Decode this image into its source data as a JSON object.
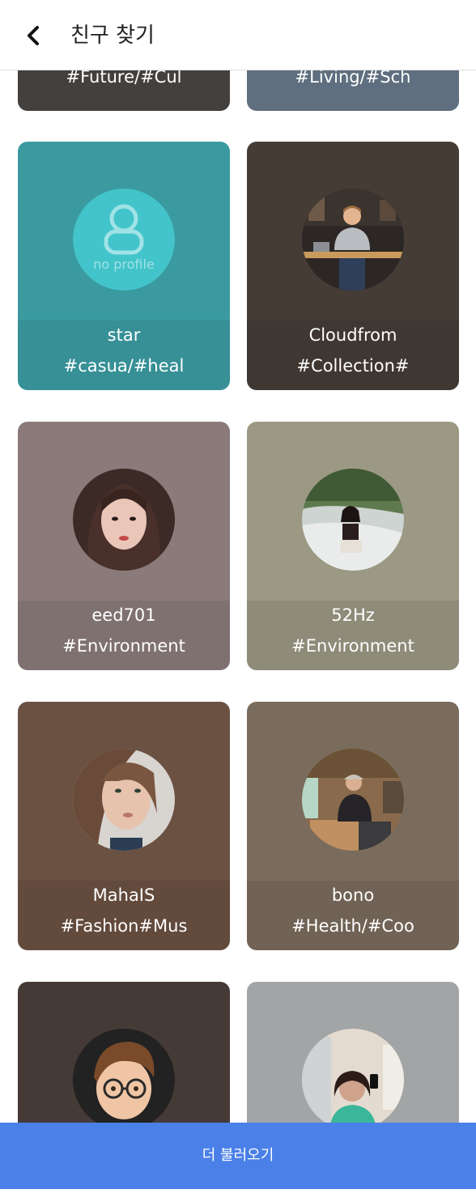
{
  "header": {
    "title": "친구 찾기",
    "back_icon": "chevron-left-icon"
  },
  "cards": [
    {
      "name": "",
      "tags": "#Future/#Cul",
      "bg": "#4a4643",
      "photo": "none"
    },
    {
      "name": "",
      "tags": "#Living/#Sch",
      "bg": "#68798a",
      "photo": "none"
    },
    {
      "name": "star",
      "tags": "#casua/#heal",
      "bg": "#3a9aa0",
      "photo": "no-profile",
      "photo_label": "no profile"
    },
    {
      "name": "Cloudfrom",
      "tags": "#Collection#",
      "bg": "#453c36",
      "photo": "man-in-cafe"
    },
    {
      "name": "eed701",
      "tags": "#Environment",
      "bg": "#8a7b7a",
      "photo": "woman-portrait"
    },
    {
      "name": "52Hz",
      "tags": "#Environment",
      "bg": "#9b9884",
      "photo": "woman-at-waterfall"
    },
    {
      "name": "MahaIS",
      "tags": "#Fashion#Mus",
      "bg": "#6b5142",
      "photo": "woman-closeup"
    },
    {
      "name": "bono",
      "tags": "#Health/#Coo",
      "bg": "#7a6c5d",
      "photo": "man-in-restaurant"
    },
    {
      "name": "",
      "tags": "",
      "bg": "#453a35",
      "photo": "memoji-avatar"
    },
    {
      "name": "",
      "tags": "",
      "bg": "#a2a5a5",
      "photo": "woman-mirror-selfie"
    }
  ],
  "load_more": {
    "label": "더 불러오기"
  }
}
